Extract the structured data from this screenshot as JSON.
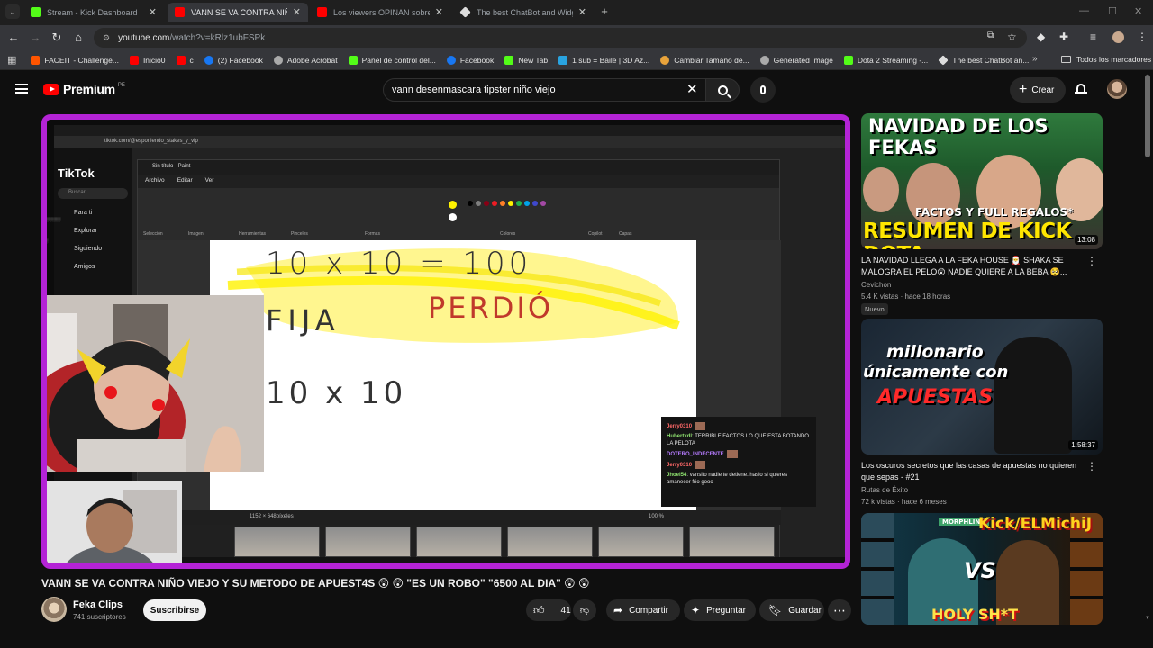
{
  "browser": {
    "tabs": [
      {
        "label": "Stream - Kick Dashboard",
        "icon": "kick-icon",
        "active": false
      },
      {
        "label": "VANN SE VA CONTRA NIÑO VIEJO",
        "icon": "youtube-icon",
        "active": true
      },
      {
        "label": "Los viewers OPINAN sobre el f",
        "icon": "youtube-icon",
        "active": false
      },
      {
        "label": "The best ChatBot and Widgets",
        "icon": "botrix-icon",
        "active": false
      }
    ],
    "url_host": "youtube.com",
    "url_rest": "/watch?v=kRlz1ubFSPk",
    "bookmarks": [
      {
        "label": "FACEIT - Challenge..."
      },
      {
        "label": "Inicio0"
      },
      {
        "label": "c"
      },
      {
        "label": "(2) Facebook"
      },
      {
        "label": "Adobe Acrobat"
      },
      {
        "label": "Panel de control del..."
      },
      {
        "label": "Facebook"
      },
      {
        "label": "New Tab"
      },
      {
        "label": "1 sub = Baile | 3D Az..."
      },
      {
        "label": "Cambiar Tamaño de..."
      },
      {
        "label": "Generated Image"
      },
      {
        "label": "Dota 2 Streaming -..."
      },
      {
        "label": "The best ChatBot an..."
      }
    ],
    "bookmarks_folder": "Todos los marcadores"
  },
  "header": {
    "logo_text": "Premium",
    "country": "PE",
    "search_query": "vann desenmascara tipster niño viejo",
    "create_label": "Crear"
  },
  "player": {
    "inner_url": "tiktok.com/@esponiendo_stakes_y_vip",
    "tiktok": {
      "logo": "TikTok",
      "search_placeholder": "Buscar",
      "items": [
        "Para ti",
        "Explorar",
        "Siguiendo",
        "Amigos"
      ]
    },
    "paint": {
      "title": "Sin título - Paint",
      "menu": [
        "Archivo",
        "Editar",
        "Ver"
      ],
      "groups": [
        "Selección",
        "Imagen",
        "Herramientas",
        "Pinceles",
        "Formas",
        "Colores",
        "Copilot",
        "Capas"
      ],
      "canvas_text": [
        "10 x 10 = 100",
        "FIJA",
        "PERDIÓ",
        "10 x 10"
      ],
      "status_size": "1152 × 648píxeles",
      "zoom": "100 %"
    },
    "chat": [
      {
        "name": "Jerry0310",
        "text": "",
        "color": "g"
      },
      {
        "name": "Hubertxdl",
        "text": "TERRIBLE FACTOS LO QUE ESTA BOTANDO LA PELOTA",
        "color": "g"
      },
      {
        "name": "DOTERO_INDECENTE",
        "text": "",
        "color": "p"
      },
      {
        "name": "Jerry0310",
        "text": "",
        "color": "r"
      },
      {
        "name": "Jhoel54",
        "text": "vansito nadie te detiene. haslo si quieres amanecer frio gooo",
        "color": "g"
      }
    ]
  },
  "video": {
    "title": "VANN SE VA CONTRA NIÑO VIEJO Y SU METODO DE APUEST4S 😲 😲 \"ES UN ROBO\" \"6500 AL DIA\" 😲 😲",
    "channel": "Feka Clips",
    "subscribers": "741 suscriptores",
    "subscribe_label": "Suscribirse",
    "likes": "41",
    "share_label": "Compartir",
    "ask_label": "Preguntar",
    "save_label": "Guardar"
  },
  "recommendations": [
    {
      "thumb_text_top": "NAVIDAD DE LOS FEKAS",
      "thumb_text_mid": "FACTOS Y FULL REGALOS*",
      "thumb_text_bottom": "RESUMEN DE KICK DOTA",
      "duration": "13:08",
      "title": "LA NAVIDAD LLEGA A LA FEKA HOUSE 🎅 SHAKA SE MALOGRA EL PELO😲 NADIE QUIERE A LA BEBA 🥺...",
      "channel": "Cevichon",
      "meta": "5.4 K vistas · hace 18 horas",
      "badge": "Nuevo"
    },
    {
      "thumb_text_top": "millonario",
      "thumb_text_mid": "únicamente con",
      "thumb_text_bottom": "APUESTAS",
      "duration": "1:58:37",
      "title": "Los oscuros secretos que las casas de apuestas no quieren que sepas - #21",
      "channel": "Rutas de Éxito",
      "meta": "72 k vistas · hace 6 meses",
      "badge": ""
    },
    {
      "thumb_text_top": "MORPHLING",
      "thumb_text_mid": "Kick/ELMichiJ",
      "thumb_text_bottom": "HOLY SH*T",
      "vs": "VS",
      "duration": "",
      "title": "",
      "channel": "",
      "meta": "",
      "badge": ""
    }
  ],
  "colors": {
    "player_border": "#b423d6",
    "youtube_red": "#ff0000",
    "kick_green": "#53fc18"
  }
}
